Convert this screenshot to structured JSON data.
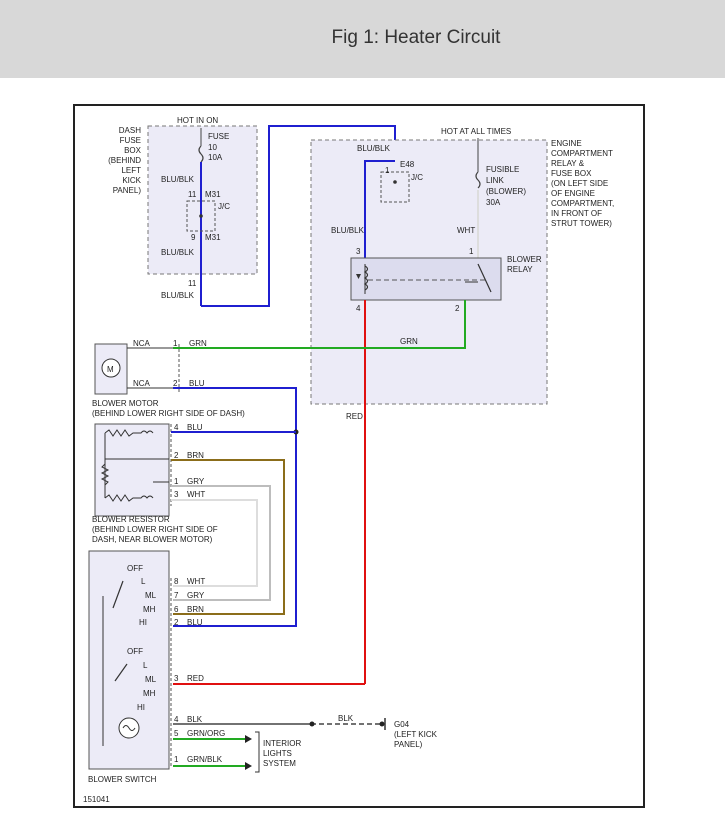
{
  "header": {
    "title": "Fig 1: Heater Circuit"
  },
  "colors": {
    "blu": "#1f1fd0",
    "grn": "#22aa22",
    "red": "#e01010",
    "brn": "#8b6d1a",
    "gry": "#bdbdbd",
    "wht": "#dddddd",
    "blk": "#444444",
    "box_fill": "#ecebf7",
    "dash": "#777777"
  },
  "fuse_box": {
    "label_lines": [
      "DASH",
      "FUSE",
      "BOX",
      "(BEHIND",
      "LEFT",
      "KICK",
      "PANEL)"
    ],
    "hot_in_on": "HOT IN ON",
    "fuse_lines": [
      "FUSE",
      "10",
      "10A"
    ],
    "wire_blu_blk_1": "BLU/BLK",
    "wire_blu_blk_2": "BLU/BLK",
    "wire_blu_blk_3": "BLU/BLK",
    "m31_pin11": "11",
    "m31_top": "M31",
    "jc": "J/C",
    "m31_pin9": "9",
    "m31_bottom": "M31",
    "pin11_bottom": "11"
  },
  "engine_box": {
    "hot_at_all_times": "HOT AT ALL TIMES",
    "label_lines": [
      "ENGINE",
      "COMPARTMENT",
      "RELAY &",
      "FUSE BOX",
      "(ON LEFT SIDE",
      "OF ENGINE",
      "COMPARTMENT,",
      "IN FRONT OF",
      "STRUT TOWER)"
    ],
    "wire_blu_blk_top": "BLU/BLK",
    "e48": "E48",
    "e48_pin1": "1",
    "e48_jc": "J/C",
    "fusible_link_lines": [
      "FUSIBLE",
      "LINK",
      "(BLOWER)",
      "30A"
    ],
    "wire_blu_blk_relay": "BLU/BLK",
    "wire_wht": "WHT",
    "relay_pin3": "3",
    "relay_pin1": "1",
    "relay_pin4": "4",
    "relay_pin2": "2",
    "relay_label_lines": [
      "BLOWER",
      "RELAY"
    ],
    "wire_grn_mid": "GRN",
    "wire_red": "RED"
  },
  "blower_motor": {
    "motor_symbol": "M",
    "nca_1": "NCA",
    "nca_2": "NCA",
    "pin1": "1",
    "wire1": "GRN",
    "pin2": "2",
    "wire2": "BLU",
    "label_lines": [
      "BLOWER MOTOR",
      "(BEHIND LOWER RIGHT SIDE OF DASH)"
    ]
  },
  "blower_resistor": {
    "pins": [
      {
        "pin": "4",
        "wire": "BLU"
      },
      {
        "pin": "2",
        "wire": "BRN"
      },
      {
        "pin": "1",
        "wire": "GRY"
      },
      {
        "pin": "3",
        "wire": "WHT"
      }
    ],
    "label_lines": [
      "BLOWER RESISTOR",
      "(BEHIND LOWER RIGHT SIDE OF",
      "DASH, NEAR BLOWER MOTOR)"
    ]
  },
  "blower_switch": {
    "upper_positions": [
      "OFF",
      "L",
      "ML",
      "MH",
      "HI"
    ],
    "lower_positions": [
      "OFF",
      "L",
      "ML",
      "MH",
      "HI"
    ],
    "pins": [
      {
        "pin": "8",
        "wire": "WHT"
      },
      {
        "pin": "7",
        "wire": "GRY"
      },
      {
        "pin": "6",
        "wire": "BRN"
      },
      {
        "pin": "2",
        "wire": "BLU"
      },
      {
        "pin": "3",
        "wire": "RED"
      },
      {
        "pin": "4",
        "wire": "BLK"
      },
      {
        "pin": "5",
        "wire": "GRN/ORG"
      },
      {
        "pin": "1",
        "wire": "GRN/BLK"
      }
    ],
    "label": "BLOWER SWITCH"
  },
  "ground": {
    "wire": "BLK",
    "code": "G04",
    "desc_lines": [
      "(LEFT KICK",
      "PANEL)"
    ]
  },
  "interior_lights_lines": [
    "INTERIOR",
    "LIGHTS",
    "SYSTEM"
  ],
  "figure_id": "151041"
}
